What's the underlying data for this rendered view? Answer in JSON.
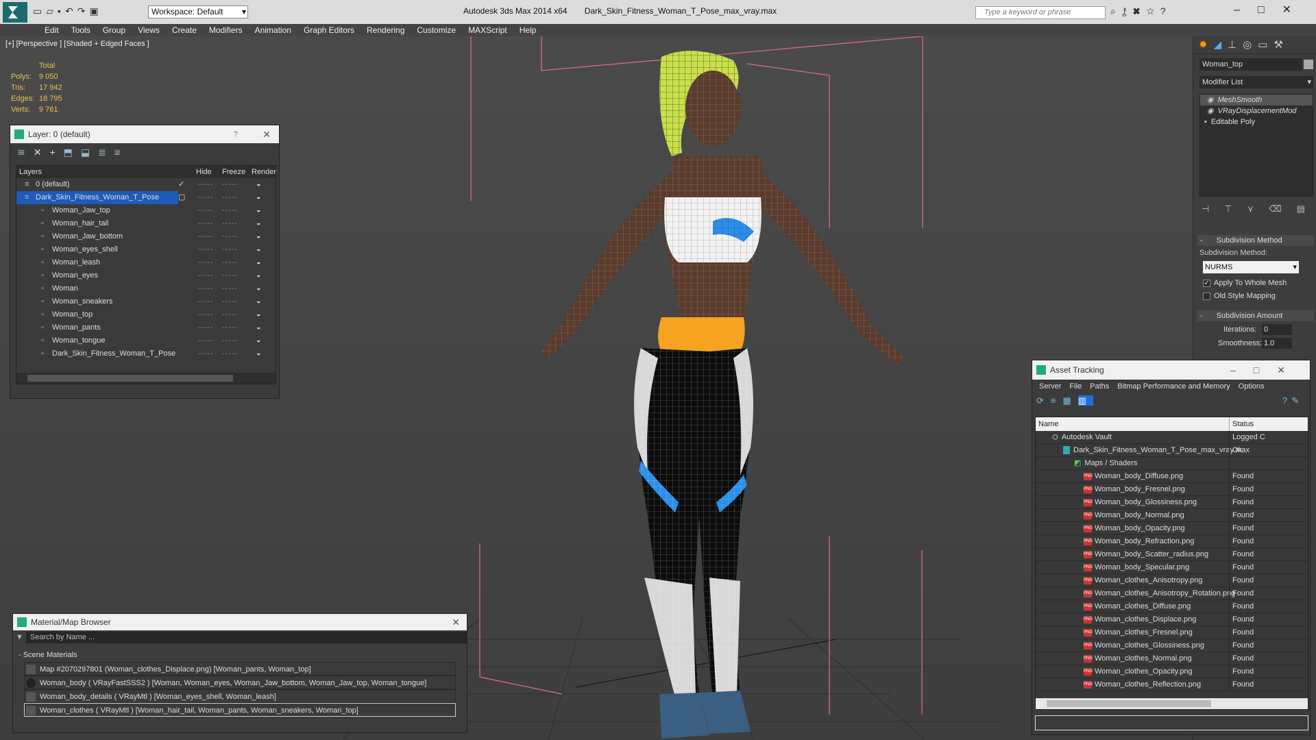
{
  "app": {
    "workspace": "Workspace: Default",
    "app_name": "Autodesk 3ds Max  2014 x64",
    "file_name": "Dark_Skin_Fitness_Woman_T_Pose_max_vray.max",
    "search_placeholder": "Type a keyword or phrase"
  },
  "menu": [
    "Edit",
    "Tools",
    "Group",
    "Views",
    "Create",
    "Modifiers",
    "Animation",
    "Graph Editors",
    "Rendering",
    "Customize",
    "MAXScript",
    "Help"
  ],
  "viewport": {
    "label": "[+] [Perspective ] [Shaded + Edged Faces ]",
    "stats_header": "Total",
    "stats": [
      {
        "label": "Polys:",
        "value": "9 050"
      },
      {
        "label": "Tris:",
        "value": "17 942"
      },
      {
        "label": "Edges:",
        "value": "18 795"
      },
      {
        "label": "Verts:",
        "value": "9 761"
      }
    ]
  },
  "layer_window": {
    "title": "Layer: 0 (default)",
    "help": "?",
    "columns": [
      "Layers",
      "Hide",
      "Freeze",
      "Render"
    ],
    "layers": [
      {
        "name": "0 (default)",
        "level": 0,
        "selected": false,
        "current": true
      },
      {
        "name": "Dark_Skin_Fitness_Woman_T_Pose",
        "level": 0,
        "selected": true,
        "current": false
      },
      {
        "name": "Woman_Jaw_top",
        "level": 1
      },
      {
        "name": "Woman_hair_tail",
        "level": 1
      },
      {
        "name": "Woman_Jaw_bottom",
        "level": 1
      },
      {
        "name": "Woman_eyes_shell",
        "level": 1
      },
      {
        "name": "Woman_leash",
        "level": 1
      },
      {
        "name": "Woman_eyes",
        "level": 1
      },
      {
        "name": "Woman",
        "level": 1
      },
      {
        "name": "Woman_sneakers",
        "level": 1
      },
      {
        "name": "Woman_top",
        "level": 1
      },
      {
        "name": "Woman_pants",
        "level": 1
      },
      {
        "name": "Woman_tongue",
        "level": 1
      },
      {
        "name": "Dark_Skin_Fitness_Woman_T_Pose",
        "level": 1
      }
    ],
    "dots": "-----"
  },
  "material_browser": {
    "title": "Material/Map Browser",
    "search_placeholder": "Search by Name ...",
    "section": "- Scene Materials",
    "items": [
      "Map #2070297801 (Woman_clothes_Displace.png)  [Woman_pants, Woman_top]",
      "Woman_body  ( VRayFastSSS2 )  [Woman, Woman_eyes, Woman_Jaw_bottom, Woman_Jaw_top, Woman_tongue]",
      "Woman_body_details  ( VRayMtl )  [Woman_eyes_shell, Woman_leash]",
      "Woman_clothes  ( VRayMtl )  [Woman_hair_tail, Woman_pants, Woman_sneakers, Woman_top]"
    ]
  },
  "command_panel": {
    "object_name": "Woman_top",
    "modifier_list": "Modifier List",
    "stack": [
      "MeshSmooth",
      "VRayDisplacementMod",
      "Editable Poly"
    ],
    "subdivision_method_header": "Subdivision Method",
    "subdivision_method_label": "Subdivision Method:",
    "subdivision_method_value": "NURMS",
    "apply_whole_mesh": "Apply To Whole Mesh",
    "old_style_mapping": "Old Style Mapping",
    "subdivision_amount_header": "Subdivision Amount",
    "iterations_label": "Iterations:",
    "iterations_value": "0",
    "smoothness_label": "Smoothness:",
    "smoothness_value": "1.0"
  },
  "asset_tracking": {
    "title": "Asset Tracking",
    "menu": [
      "Server",
      "File",
      "Paths",
      "Bitmap Performance and Memory",
      "Options"
    ],
    "columns": [
      "Name",
      "Status"
    ],
    "rows": [
      {
        "name": "Autodesk Vault",
        "status": "Logged C",
        "level": 0,
        "kind": "vault"
      },
      {
        "name": "Dark_Skin_Fitness_Woman_T_Pose_max_vray.max",
        "status": "Ok",
        "level": 1,
        "kind": "max"
      },
      {
        "name": "Maps / Shaders",
        "status": "",
        "level": 2,
        "kind": "folder"
      },
      {
        "name": "Woman_body_Diffuse.png",
        "status": "Found",
        "level": 3,
        "kind": "png"
      },
      {
        "name": "Woman_body_Fresnel.png",
        "status": "Found",
        "level": 3,
        "kind": "png"
      },
      {
        "name": "Woman_body_Glossiness.png",
        "status": "Found",
        "level": 3,
        "kind": "png"
      },
      {
        "name": "Woman_body_Normal.png",
        "status": "Found",
        "level": 3,
        "kind": "png"
      },
      {
        "name": "Woman_body_Opacity.png",
        "status": "Found",
        "level": 3,
        "kind": "png"
      },
      {
        "name": "Woman_body_Refraction.png",
        "status": "Found",
        "level": 3,
        "kind": "png"
      },
      {
        "name": "Woman_body_Scatter_radius.png",
        "status": "Found",
        "level": 3,
        "kind": "png"
      },
      {
        "name": "Woman_body_Specular.png",
        "status": "Found",
        "level": 3,
        "kind": "png"
      },
      {
        "name": "Woman_clothes_Anisotropy.png",
        "status": "Found",
        "level": 3,
        "kind": "png"
      },
      {
        "name": "Woman_clothes_Anisotropy_Rotation.png",
        "status": "Found",
        "level": 3,
        "kind": "png"
      },
      {
        "name": "Woman_clothes_Diffuse.png",
        "status": "Found",
        "level": 3,
        "kind": "png"
      },
      {
        "name": "Woman_clothes_Displace.png",
        "status": "Found",
        "level": 3,
        "kind": "png"
      },
      {
        "name": "Woman_clothes_Fresnel.png",
        "status": "Found",
        "level": 3,
        "kind": "png"
      },
      {
        "name": "Woman_clothes_Glossiness.png",
        "status": "Found",
        "level": 3,
        "kind": "png"
      },
      {
        "name": "Woman_clothes_Normal.png",
        "status": "Found",
        "level": 3,
        "kind": "png"
      },
      {
        "name": "Woman_clothes_Opacity.png",
        "status": "Found",
        "level": 3,
        "kind": "png"
      },
      {
        "name": "Woman_clothes_Reflection.png",
        "status": "Found",
        "level": 3,
        "kind": "png"
      }
    ]
  },
  "colors": {
    "accent": "#1e6fd9",
    "selection": "#1e5bb8",
    "found": "#dddddd"
  }
}
